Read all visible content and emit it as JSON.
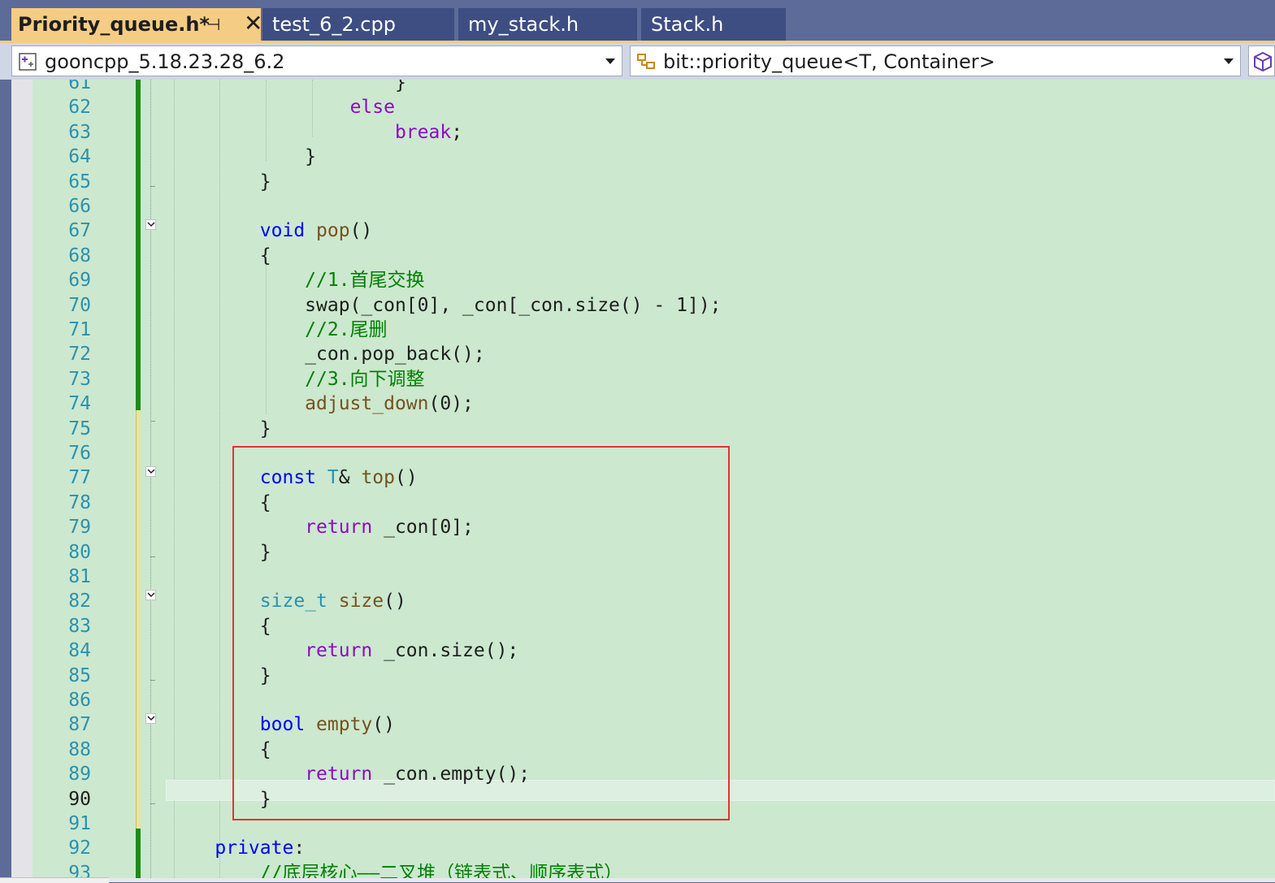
{
  "tabs": [
    {
      "label": "Priority_queue.h*",
      "active": true
    },
    {
      "label": "test_6_2.cpp",
      "active": false
    },
    {
      "label": "my_stack.h",
      "active": false
    },
    {
      "label": "Stack.h",
      "active": false
    }
  ],
  "tab_controls": {
    "pin_glyph": "⊣",
    "close_glyph": "✕"
  },
  "navbar": {
    "project_combo": "gooncpp_5.18.23.28_6.2",
    "scope_combo": "bit::priority_queue<T, Container>"
  },
  "colors": {
    "editor_bg": "#cce8cf",
    "keyword": "#0000ff",
    "control": "#8f08c4",
    "type": "#2b91af",
    "function": "#74531f",
    "comment": "#008000",
    "line_number": "#2b91af",
    "highlight_box": "#e2323a",
    "change_saved": "#1b8c1b",
    "change_unsaved": "#e8e4a0"
  },
  "editor": {
    "current_line": 90,
    "lines": [
      {
        "n": "61",
        "tokens": [
          {
            "t": "                    }",
            "c": "plain"
          }
        ]
      },
      {
        "n": "62",
        "tokens": [
          {
            "t": "                ",
            "c": "plain"
          },
          {
            "t": "else",
            "c": "ctrl"
          }
        ]
      },
      {
        "n": "63",
        "tokens": [
          {
            "t": "                    ",
            "c": "plain"
          },
          {
            "t": "break",
            "c": "ctrl"
          },
          {
            "t": ";",
            "c": "plain"
          }
        ]
      },
      {
        "n": "64",
        "tokens": [
          {
            "t": "            }",
            "c": "plain"
          }
        ]
      },
      {
        "n": "65",
        "tokens": [
          {
            "t": "        }",
            "c": "plain"
          }
        ]
      },
      {
        "n": "66",
        "tokens": []
      },
      {
        "n": "67",
        "tokens": [
          {
            "t": "        ",
            "c": "plain"
          },
          {
            "t": "void",
            "c": "kw"
          },
          {
            "t": " ",
            "c": "plain"
          },
          {
            "t": "pop",
            "c": "fn"
          },
          {
            "t": "()",
            "c": "plain"
          }
        ]
      },
      {
        "n": "68",
        "tokens": [
          {
            "t": "        {",
            "c": "plain"
          }
        ]
      },
      {
        "n": "69",
        "tokens": [
          {
            "t": "            ",
            "c": "plain"
          },
          {
            "t": "//1.首尾交换",
            "c": "cmt"
          }
        ]
      },
      {
        "n": "70",
        "tokens": [
          {
            "t": "            swap(_con[0], _con[_con.size() - 1]);",
            "c": "plain"
          }
        ]
      },
      {
        "n": "71",
        "tokens": [
          {
            "t": "            ",
            "c": "plain"
          },
          {
            "t": "//2.尾删",
            "c": "cmt"
          }
        ]
      },
      {
        "n": "72",
        "tokens": [
          {
            "t": "            _con.pop_back();",
            "c": "plain"
          }
        ]
      },
      {
        "n": "73",
        "tokens": [
          {
            "t": "            ",
            "c": "plain"
          },
          {
            "t": "//3.向下调整",
            "c": "cmt"
          }
        ]
      },
      {
        "n": "74",
        "tokens": [
          {
            "t": "            ",
            "c": "plain"
          },
          {
            "t": "adjust_down",
            "c": "fn"
          },
          {
            "t": "(0);",
            "c": "plain"
          }
        ]
      },
      {
        "n": "75",
        "tokens": [
          {
            "t": "        }",
            "c": "plain"
          }
        ]
      },
      {
        "n": "76",
        "tokens": []
      },
      {
        "n": "77",
        "tokens": [
          {
            "t": "        ",
            "c": "plain"
          },
          {
            "t": "const",
            "c": "kw"
          },
          {
            "t": " ",
            "c": "plain"
          },
          {
            "t": "T",
            "c": "type"
          },
          {
            "t": "& ",
            "c": "plain"
          },
          {
            "t": "top",
            "c": "fn"
          },
          {
            "t": "()",
            "c": "plain"
          }
        ]
      },
      {
        "n": "78",
        "tokens": [
          {
            "t": "        {",
            "c": "plain"
          }
        ]
      },
      {
        "n": "79",
        "tokens": [
          {
            "t": "            ",
            "c": "plain"
          },
          {
            "t": "return",
            "c": "ctrl"
          },
          {
            "t": " _con[0];",
            "c": "plain"
          }
        ]
      },
      {
        "n": "80",
        "tokens": [
          {
            "t": "        }",
            "c": "plain"
          }
        ]
      },
      {
        "n": "81",
        "tokens": []
      },
      {
        "n": "82",
        "tokens": [
          {
            "t": "        ",
            "c": "plain"
          },
          {
            "t": "size_t",
            "c": "type"
          },
          {
            "t": " ",
            "c": "plain"
          },
          {
            "t": "size",
            "c": "fn"
          },
          {
            "t": "()",
            "c": "plain"
          }
        ]
      },
      {
        "n": "83",
        "tokens": [
          {
            "t": "        {",
            "c": "plain"
          }
        ]
      },
      {
        "n": "84",
        "tokens": [
          {
            "t": "            ",
            "c": "plain"
          },
          {
            "t": "return",
            "c": "ctrl"
          },
          {
            "t": " _con.size();",
            "c": "plain"
          }
        ]
      },
      {
        "n": "85",
        "tokens": [
          {
            "t": "        }",
            "c": "plain"
          }
        ]
      },
      {
        "n": "86",
        "tokens": []
      },
      {
        "n": "87",
        "tokens": [
          {
            "t": "        ",
            "c": "plain"
          },
          {
            "t": "bool",
            "c": "kw"
          },
          {
            "t": " ",
            "c": "plain"
          },
          {
            "t": "empty",
            "c": "fn"
          },
          {
            "t": "()",
            "c": "plain"
          }
        ]
      },
      {
        "n": "88",
        "tokens": [
          {
            "t": "        {",
            "c": "plain"
          }
        ]
      },
      {
        "n": "89",
        "tokens": [
          {
            "t": "            ",
            "c": "plain"
          },
          {
            "t": "return",
            "c": "ctrl"
          },
          {
            "t": " _con.empty();",
            "c": "plain"
          }
        ]
      },
      {
        "n": "90",
        "tokens": [
          {
            "t": "        }",
            "c": "plain"
          }
        ]
      },
      {
        "n": "91",
        "tokens": []
      },
      {
        "n": "92",
        "tokens": [
          {
            "t": "    ",
            "c": "plain"
          },
          {
            "t": "private",
            "c": "kw"
          },
          {
            "t": ":",
            "c": "plain"
          }
        ]
      },
      {
        "n": "93",
        "tokens": [
          {
            "t": "        ",
            "c": "plain"
          },
          {
            "t": "//底层核心——二叉堆（链表式、顺序表式）",
            "c": "cmt"
          }
        ]
      }
    ]
  }
}
